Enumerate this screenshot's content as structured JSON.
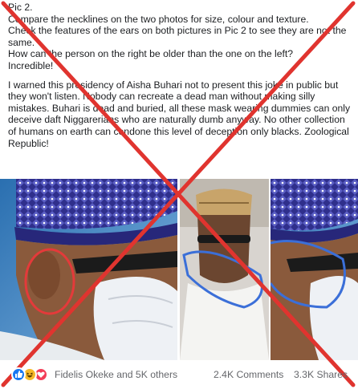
{
  "post": {
    "paragraph1": [
      "Pic 2.",
      "Compare the necklines on the two photos for size, colour and texture.",
      "Check the features of the ears on both pictures in Pic 2 to see they are not the same.",
      "How can the person on the right be older than the one on the left?",
      "Incredible!"
    ],
    "paragraph2": "I warned this presidency of Aisha Buhari not to present this joke in public but they won't listen. Nobody can recreate a dead man without making silly mistakes. Buhari is dead and buried, all these mask wearing dummies can only deceive daft Niggarerians who are naturally dumb anyway. No other collection of humans on earth can condone this level of deception only blacks. Zoological Republic!"
  },
  "photos": {
    "left_caption": "",
    "middle_caption": "",
    "right_caption": ""
  },
  "colors": {
    "cross": "#e0342f",
    "circle_red": "#e43a3a",
    "circle_blue": "#3b6fd8",
    "cap_blue": "#3d3f9e",
    "mask_white": "#f1f3f6"
  },
  "footer": {
    "reaction_icons": [
      "like-icon",
      "haha-icon",
      "love-icon"
    ],
    "reactions_text": "Fidelis Okeke and 5K others",
    "comments_text": "2.4K Comments",
    "shares_text": "3.3K Shares"
  }
}
